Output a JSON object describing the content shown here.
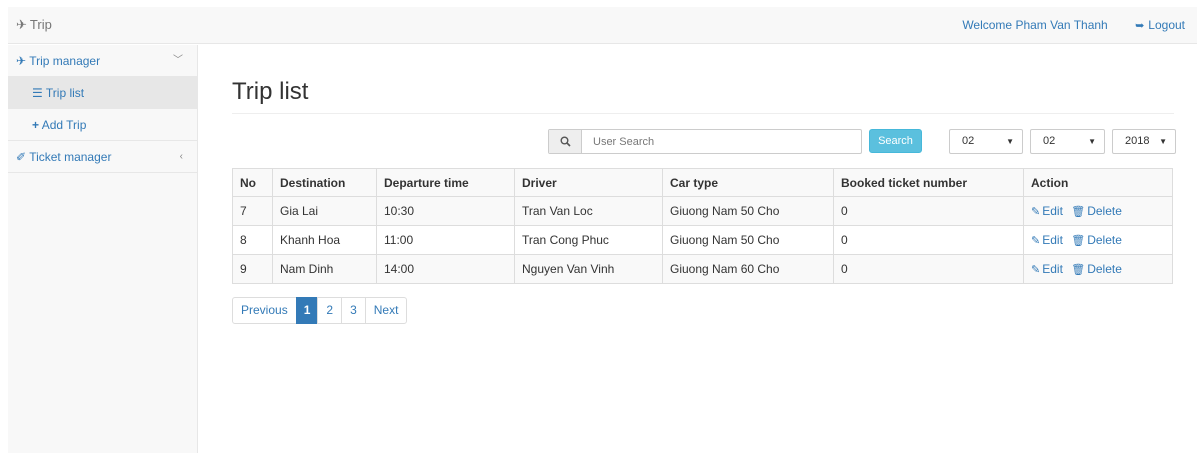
{
  "app": {
    "brand": "Trip",
    "brand_icon": "plane-icon"
  },
  "header": {
    "welcome": "Welcome Pham Van Thanh",
    "logout": "Logout",
    "logout_icon": "logout-icon"
  },
  "sidebar": {
    "trip_manager": "Trip manager",
    "trip_list": "Trip list",
    "add_trip": "Add Trip",
    "ticket_manager": "Ticket manager"
  },
  "main": {
    "title": "Trip list"
  },
  "search": {
    "placeholder": "User Search",
    "button": "Search"
  },
  "filters": {
    "month": "02",
    "day": "02",
    "year": "2018"
  },
  "table": {
    "headers": [
      "No",
      "Destination",
      "Departure time",
      "Driver",
      "Car type",
      "Booked ticket number",
      "Action"
    ],
    "rows": [
      {
        "no": "7",
        "destination": "Gia Lai",
        "time": "10:30",
        "driver": "Tran Van Loc",
        "car": "Giuong Nam 50 Cho",
        "booked": "0"
      },
      {
        "no": "8",
        "destination": "Khanh Hoa",
        "time": "11:00",
        "driver": "Tran Cong Phuc",
        "car": "Giuong Nam 50 Cho",
        "booked": "0"
      },
      {
        "no": "9",
        "destination": "Nam Dinh",
        "time": "14:00",
        "driver": "Nguyen Van Vinh",
        "car": "Giuong Nam 60 Cho",
        "booked": "0"
      }
    ],
    "edit_label": "Edit",
    "delete_label": "Delete"
  },
  "pagination": {
    "previous": "Previous",
    "pages": [
      "1",
      "2",
      "3"
    ],
    "next": "Next",
    "current": "1"
  },
  "colors": {
    "link": "#337ab7",
    "search_button": "#5bc0de",
    "active_page": "#337ab7"
  }
}
